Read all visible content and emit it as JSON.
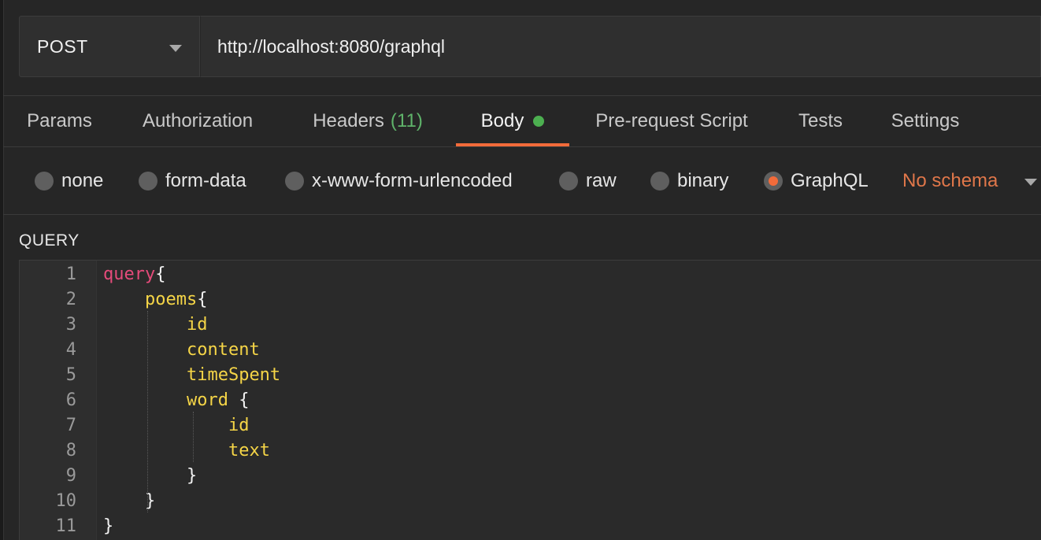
{
  "request": {
    "method": "POST",
    "url": "http://localhost:8080/graphql"
  },
  "tabs": [
    {
      "label": "Params"
    },
    {
      "label": "Authorization"
    },
    {
      "label": "Headers",
      "count": "(11)"
    },
    {
      "label": "Body",
      "active": true
    },
    {
      "label": "Pre-request Script"
    },
    {
      "label": "Tests"
    },
    {
      "label": "Settings"
    }
  ],
  "body_types": [
    {
      "label": "none"
    },
    {
      "label": "form-data"
    },
    {
      "label": "x-www-form-urlencoded"
    },
    {
      "label": "raw"
    },
    {
      "label": "binary"
    },
    {
      "label": "GraphQL",
      "selected": true
    }
  ],
  "schema": {
    "label": "No schema"
  },
  "query_section": {
    "label": "QUERY"
  },
  "editor": {
    "lines": [
      {
        "num": "1",
        "indent": "",
        "tokens": [
          {
            "t": "query",
            "c": "kw"
          },
          {
            "t": "{",
            "c": "pun"
          }
        ]
      },
      {
        "num": "2",
        "indent": "    ",
        "tokens": [
          {
            "t": "poems",
            "c": "fld"
          },
          {
            "t": "{",
            "c": "pun"
          }
        ]
      },
      {
        "num": "3",
        "indent": "        ",
        "tokens": [
          {
            "t": "id",
            "c": "fld"
          }
        ]
      },
      {
        "num": "4",
        "indent": "        ",
        "tokens": [
          {
            "t": "content",
            "c": "fld"
          }
        ]
      },
      {
        "num": "5",
        "indent": "        ",
        "tokens": [
          {
            "t": "timeSpent",
            "c": "fld"
          }
        ]
      },
      {
        "num": "6",
        "indent": "        ",
        "tokens": [
          {
            "t": "word",
            "c": "fld"
          },
          {
            "t": " {",
            "c": "pun"
          }
        ]
      },
      {
        "num": "7",
        "indent": "            ",
        "tokens": [
          {
            "t": "id",
            "c": "fld"
          }
        ]
      },
      {
        "num": "8",
        "indent": "            ",
        "tokens": [
          {
            "t": "text",
            "c": "fld"
          }
        ]
      },
      {
        "num": "9",
        "indent": "        ",
        "tokens": [
          {
            "t": "}",
            "c": "pun"
          }
        ]
      },
      {
        "num": "10",
        "indent": "    ",
        "tokens": [
          {
            "t": "}",
            "c": "pun"
          }
        ]
      },
      {
        "num": "11",
        "indent": "",
        "tokens": [
          {
            "t": "}",
            "c": "pun"
          }
        ]
      }
    ]
  },
  "colors": {
    "accent": "#f26b3a",
    "keyword": "#e54b7a",
    "field": "#f5d547",
    "body_dot": "#4caf50",
    "headers_count": "#5fb36a"
  }
}
